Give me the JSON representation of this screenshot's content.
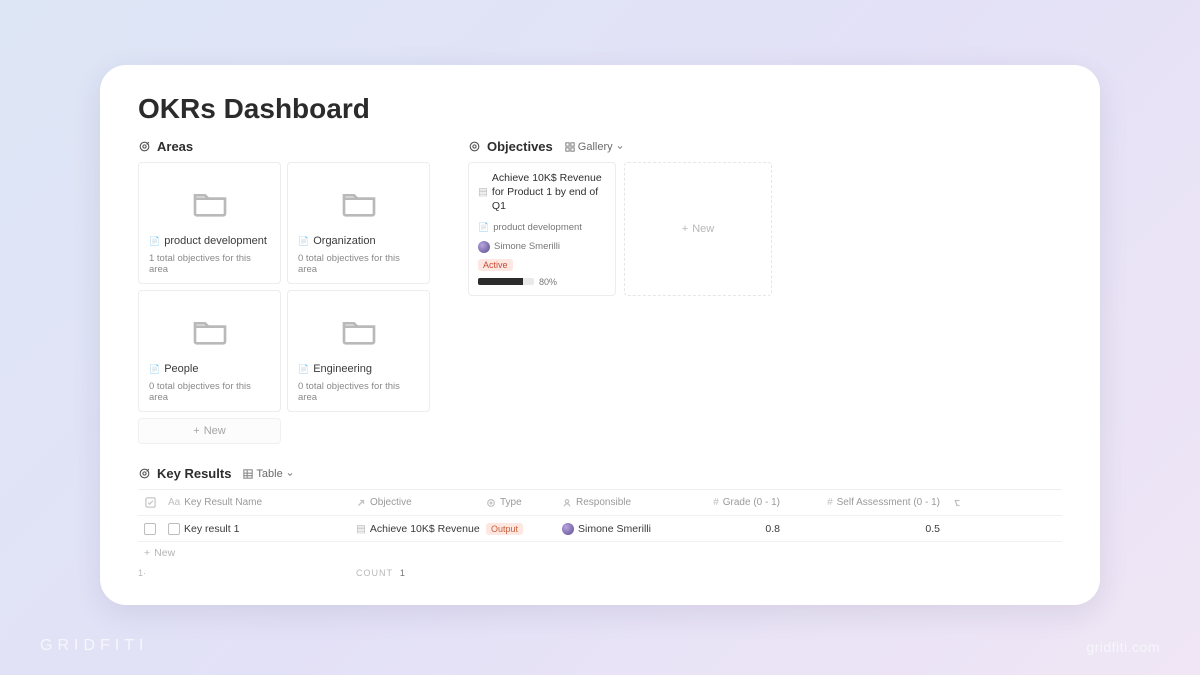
{
  "brand": {
    "name": "GRIDFITI",
    "site": "gridfiti.com"
  },
  "page": {
    "title": "OKRs Dashboard"
  },
  "areas": {
    "heading": "Areas",
    "items": [
      {
        "name": "product development",
        "sub": "1 total objectives for this area"
      },
      {
        "name": "Organization",
        "sub": "0 total objectives for this area"
      },
      {
        "name": "People",
        "sub": "0 total objectives for this area"
      },
      {
        "name": "Engineering",
        "sub": "0 total objectives for this area"
      }
    ],
    "new_label": "New"
  },
  "objectives": {
    "heading": "Objectives",
    "view_label": "Gallery",
    "card": {
      "title": "Achieve 10K$ Revenue for Product 1 by end of Q1",
      "area": "product development",
      "owner": "Simone Smerilli",
      "status": "Active",
      "progress_pct": 80,
      "progress_label": "80%"
    },
    "new_label": "New"
  },
  "key_results": {
    "heading": "Key Results",
    "view_label": "Table",
    "columns": {
      "name": "Key Result Name",
      "objective": "Objective",
      "type": "Type",
      "responsible": "Responsible",
      "grade": "Grade (0 - 1)",
      "self": "Self Assessment (0 - 1)"
    },
    "rows": [
      {
        "name": "Key result 1",
        "objective": "Achieve 10K$ Revenue fo",
        "type": "Output",
        "responsible": "Simone Smerilli",
        "grade": "0.8",
        "self": "0.5"
      }
    ],
    "new_label": "New",
    "footer_left": "1·",
    "count_label": "COUNT",
    "count_value": "1"
  }
}
